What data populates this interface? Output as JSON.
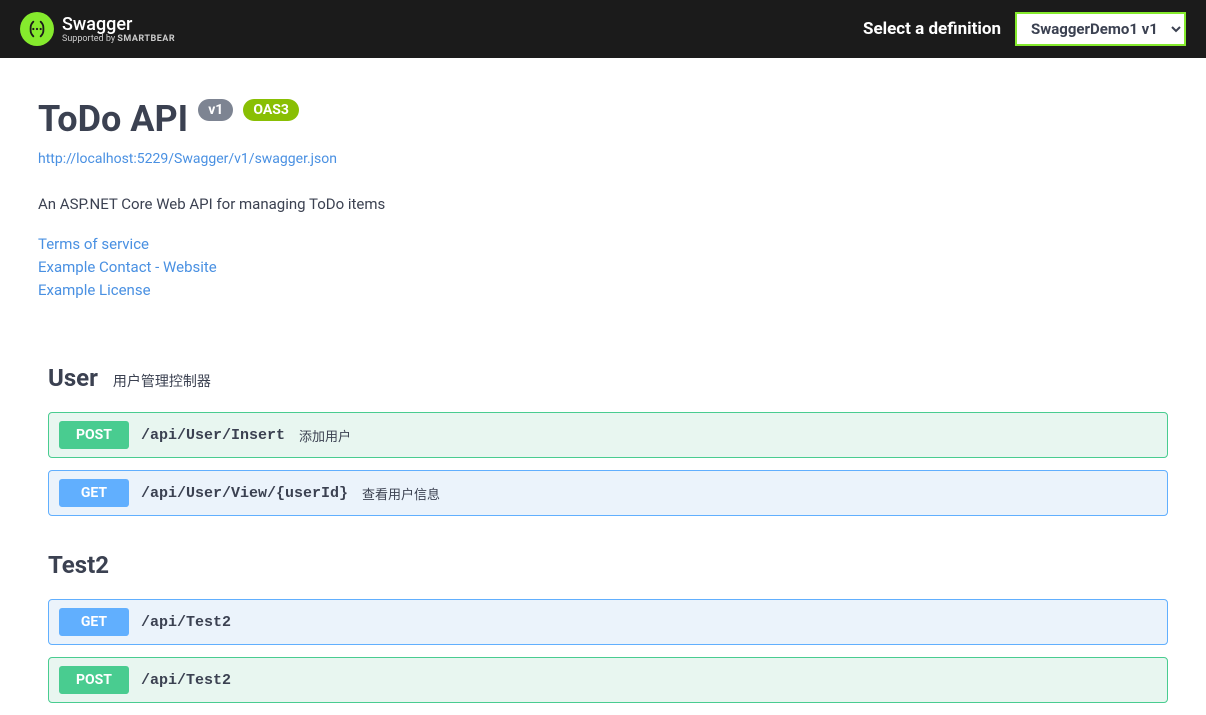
{
  "topbar": {
    "brand": "Swagger",
    "supported_by_prefix": "Supported by ",
    "supported_by_name": "SMARTBEAR",
    "select_label": "Select a definition",
    "definition": "SwaggerDemo1 v1"
  },
  "api": {
    "title": "ToDo API",
    "version": "v1",
    "oas": "OAS3",
    "url": "http://localhost:5229/Swagger/v1/swagger.json",
    "description": "An ASP.NET Core Web API for managing ToDo items",
    "terms": "Terms of service",
    "contact": "Example Contact - Website",
    "license": "Example License"
  },
  "tags": [
    {
      "name": "User",
      "description": "用户管理控制器",
      "ops": [
        {
          "method": "POST",
          "method_class": "post",
          "path": "/api/User/Insert",
          "summary": "添加用户"
        },
        {
          "method": "GET",
          "method_class": "get",
          "path": "/api/User/View/{userId}",
          "summary": "查看用户信息"
        }
      ]
    },
    {
      "name": "Test2",
      "description": "",
      "ops": [
        {
          "method": "GET",
          "method_class": "get",
          "path": "/api/Test2",
          "summary": ""
        },
        {
          "method": "POST",
          "method_class": "post",
          "path": "/api/Test2",
          "summary": ""
        }
      ]
    }
  ]
}
